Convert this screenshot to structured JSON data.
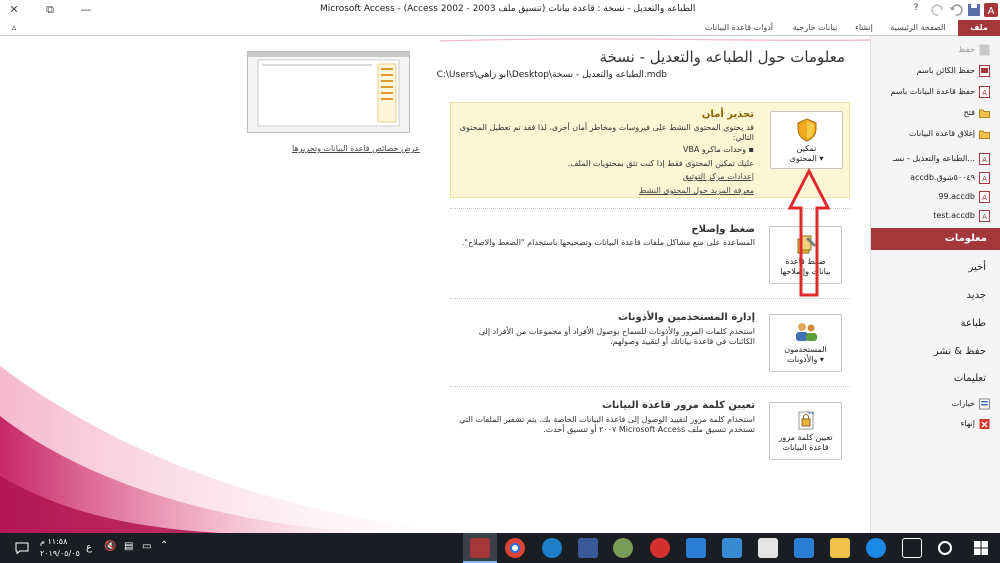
{
  "window": {
    "title": "Microsoft Access - (Access 2002 - 2003 الطباعه والتعديل - نسخة : قاعدة بيانات (تنسيق ملف",
    "minimize": "—",
    "restore": "⧉",
    "close": "✕",
    "help": "?",
    "ribbon_min": "▵"
  },
  "ribbon_tabs": [
    "ملف",
    "الصفحة الرئيسية",
    "إنشاء",
    "بيانات خارجية",
    "أدوات قاعدة البيانات"
  ],
  "page": {
    "title": "معلومات حول الطباعه والتعديل - نسخة",
    "path": "C:\\Users\\ابو زاهي\\Desktop\\الطباعه والتعديل - نسخة.mdb",
    "thumb_link": "عرض خصائص قاعدة البيانات وتحريرها"
  },
  "security": {
    "button_label_1": "تمكين",
    "button_label_2": "المحتوى ▾",
    "title": "تحذير أمان",
    "desc": "قد يحتوي المحتوى النشط على فيروسات ومخاطر أمان أخرى، لذا فقد تم تعطيل المحتوى التالي:",
    "bullet": "وحدات ماكرو VBA",
    "trust": "عليك تمكين المحتوى فقط إذا كنت تثق بمحتويات الملف.",
    "link_trust_center": "إعدادات مركز التوثيق",
    "link_learn_more": "معرفة المزيد حول المحتوى النشط"
  },
  "compact": {
    "button_label_1": "ضغط قاعدة",
    "button_label_2": "بيانات وإصلاحها",
    "title": "ضغط وإصلاح",
    "desc": "المساعدة على منع مشاكل ملفات قاعدة البيانات وتصحيحها باستخدام \"الضغط والاصلاح\"."
  },
  "users": {
    "button_label_1": "المستخدمون",
    "button_label_2": "والأذونات ▾",
    "title": "إدارة المستخدمين والأذونات",
    "desc": "استخدم كلمات المرور والأذونات للسماح بوصول الأفراد أو مجموعات من الأفراد إلى الكائنات في قاعدة بياناتك أو لتقييد وصولهم."
  },
  "password": {
    "button_label_1": "تعيين كلمة مرور",
    "button_label_2": "قاعدة البيانات",
    "title": "تعيين كلمة مرور قاعدة البيانات",
    "desc": "استخدام كلمة مرور لتقييد الوصول إلى قاعدة البيانات الخاصة بك. يتم تشفير الملفات التي تستخدم تنسيق ملف Microsoft Access ٢٠٠٧ أو تنسيق أحدث."
  },
  "sidebar": {
    "items": [
      {
        "label": "حفظ",
        "dim": true
      },
      {
        "label": "حفظ الكائن باسم"
      },
      {
        "label": "حفظ قاعدة البيانات باسم"
      },
      {
        "label": "فتح"
      },
      {
        "label": "إغلاق قاعدة البيانات"
      },
      {
        "label": "الطباعه والتعديل - نسـ..."
      },
      {
        "label": "accdb.٥٠٠٤٩شوق"
      },
      {
        "label": "99.accdb"
      },
      {
        "label": "test.accdb"
      }
    ],
    "active": "معلومات",
    "big_items": [
      "أخير",
      "جديد",
      "طباعة",
      "حفظ & نشر",
      "تعليمات"
    ],
    "options": "خيارات",
    "exit": "إنهاء"
  },
  "taskbar": {
    "time": "١١:٥٨ م",
    "date": "٢٠١٩/٠٥/٠٥",
    "lang": "ع"
  },
  "colors": {
    "accent": "#a4373a",
    "warning_bg": "#fdf6d5",
    "arrow": "#e0282d"
  }
}
